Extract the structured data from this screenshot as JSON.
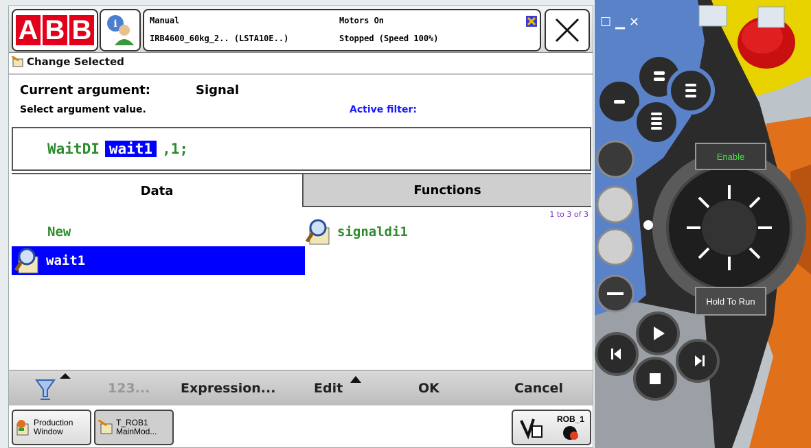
{
  "header": {
    "logo_letters": [
      "A",
      "B",
      "B"
    ],
    "mode": "Manual",
    "system": "IRB4600_60kg_2.. (LSTA10E..)",
    "motor_state": "Motors On",
    "run_state": "Stopped (Speed 100%)"
  },
  "window_title": "Change Selected",
  "argument": {
    "label": "Current argument:",
    "value": "Signal",
    "instruction": "Select argument value.",
    "filter_label": "Active filter:"
  },
  "code": {
    "instruction": "WaitDI",
    "selected_arg": "wait1",
    "rest": ",1;"
  },
  "tabs": {
    "data": "Data",
    "functions": "Functions"
  },
  "list": {
    "page_count": "1 to 3 of 3",
    "items": [
      "New",
      "wait1",
      "signaldi1"
    ]
  },
  "bottom_bar": {
    "num": "123...",
    "expression": "Expression...",
    "edit": "Edit",
    "ok": "OK",
    "cancel": "Cancel"
  },
  "taskbar": {
    "production_line1": "Production",
    "production_line2": "Window",
    "trob_line1": "T_ROB1",
    "trob_line2": "MainMod...",
    "rob_label": "ROB_1"
  },
  "device": {
    "enable": "Enable",
    "hold_to_run": "Hold To Run"
  },
  "colors": {
    "abb_red": "#e2001a",
    "selection_blue": "#0000ff",
    "code_green": "#2e8b2e",
    "filter_blue": "#1a1aff"
  }
}
